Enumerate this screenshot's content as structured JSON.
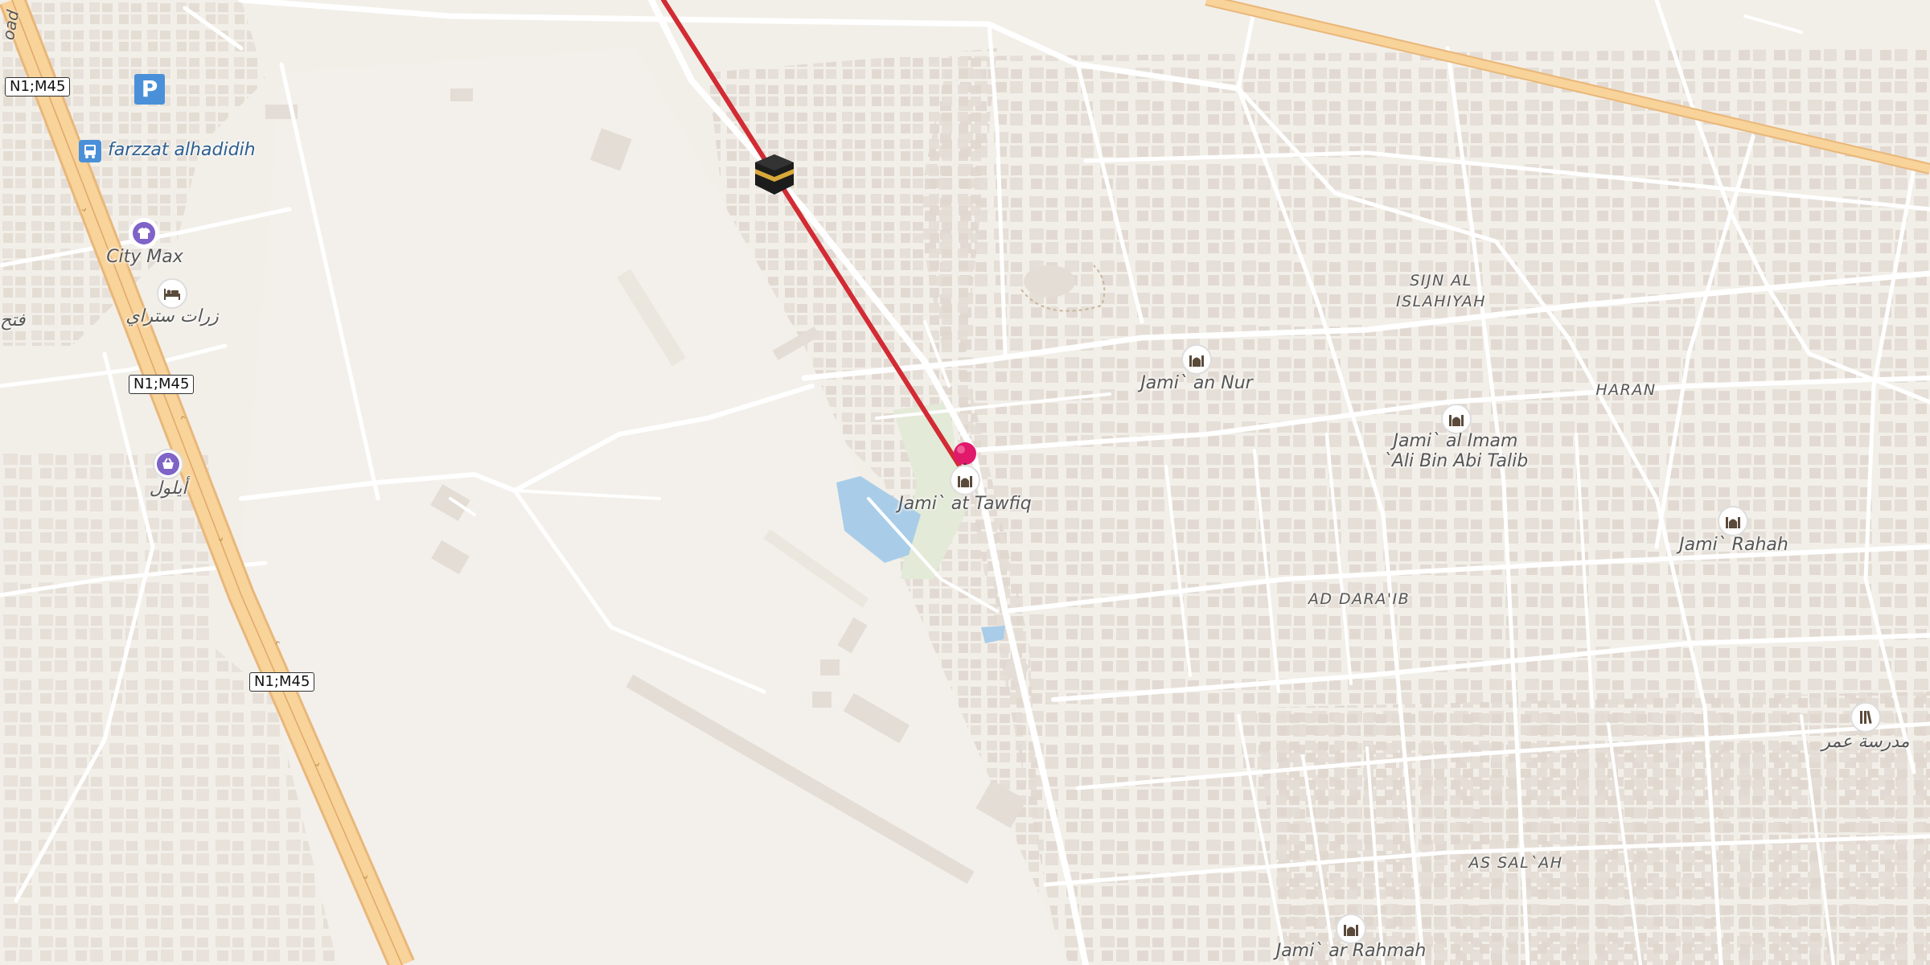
{
  "road_shields": [
    "N1;M45",
    "N1;M45",
    "N1;M45"
  ],
  "street_fragment": "oad",
  "labels": {
    "farzzat": "farzzat alhadidih",
    "city_max": "City Max",
    "hotel": "زرات ستراي",
    "fath": "فتح",
    "aylool": "أيلول",
    "jami_tawfiq": "Jami` at Tawfiq",
    "jami_nur": "Jami` an Nur",
    "jami_imam_line1": "Jami` al Imam",
    "jami_imam_line2": "`Ali Bin Abi Talib",
    "jami_rahah": "Jami` Rahah",
    "jami_rahmah": "Jami` ar Rahmah",
    "school": "مدرسة عمر"
  },
  "areas": {
    "sijn_line1": "SIJN AL",
    "sijn_line2": "ISLAHIYAH",
    "haran": "HARAN",
    "ad_daraib": "AD DARA'IB",
    "as_salah": "AS SAL`AH"
  },
  "icons": {
    "parking": "P",
    "bus": "bus-stop-icon",
    "clothes": "clothes-shop-icon",
    "hotel": "hotel-icon",
    "basket": "shopping-basket-icon",
    "mosque": "mosque-icon",
    "kaaba": "kaaba-icon",
    "pin": "location-pin-icon",
    "school": "school-icon"
  },
  "colors": {
    "background": "#f2efe9",
    "road": "#ffffff",
    "highway": "#f8d39a",
    "route": "#d22b34",
    "water": "#a9cde8",
    "park": "#e3ead8",
    "building": "#e4ddd5",
    "label": "#555555"
  }
}
